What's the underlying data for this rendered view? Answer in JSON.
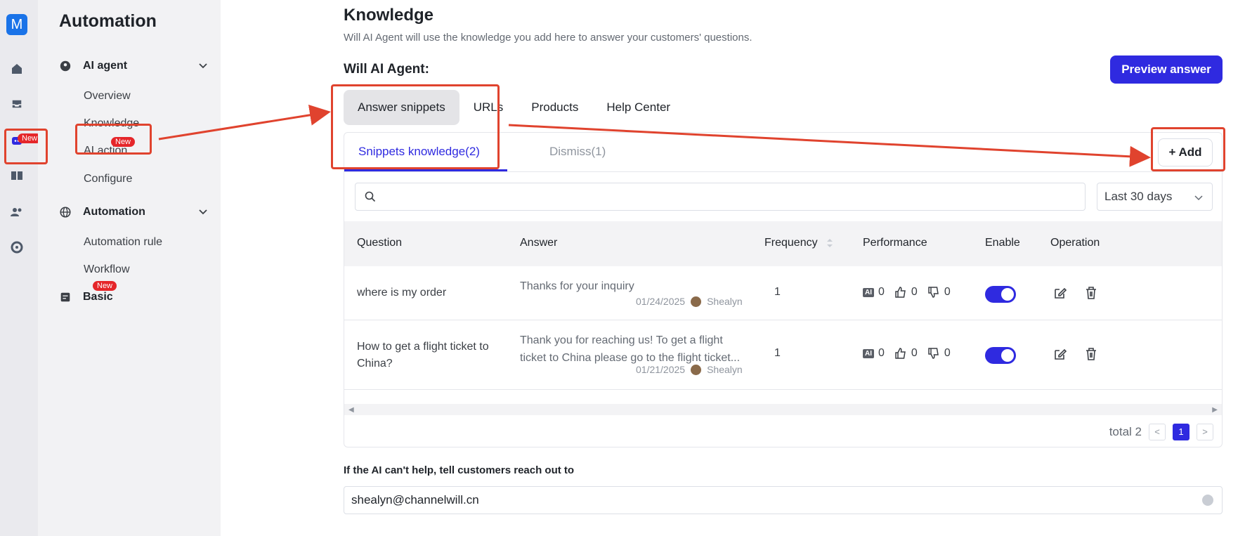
{
  "rail": {
    "logo": "M",
    "new_badge": "New"
  },
  "sidebar": {
    "title": "Automation",
    "groups": [
      {
        "label": "AI agent",
        "items": [
          "Overview",
          "Knowledge",
          "AI action",
          "Configure"
        ],
        "item_badges": {
          "AI action": "New"
        }
      },
      {
        "label": "Automation",
        "items": [
          "Automation rule",
          "Workflow"
        ]
      },
      {
        "label": "Basic",
        "badge": "New"
      }
    ]
  },
  "main": {
    "title": "Knowledge",
    "description": "Will AI Agent will use the knowledge you add here to answer your customers' questions.",
    "subtitle": "Will AI Agent:",
    "preview_button": "Preview answer",
    "tabs": [
      "Answer snippets",
      "URLs",
      "Products",
      "Help Center"
    ],
    "subtabs": [
      "Snippets knowledge(2)",
      "Dismiss(1)"
    ],
    "add_button": "+ Add",
    "search": {
      "placeholder": ""
    },
    "date_range": "Last 30 days",
    "columns": [
      "Question",
      "Answer",
      "Frequency",
      "Performance",
      "Enable",
      "Operation"
    ],
    "rows": [
      {
        "question": "where is my order",
        "answer": "Thanks for your inquiry",
        "date": "01/24/2025",
        "author": "Shealyn",
        "frequency": "1",
        "ai": "0",
        "up": "0",
        "down": "0",
        "enabled": true
      },
      {
        "question": "How to get a flight ticket to China?",
        "answer": "Thank you for reaching us! To get a flight ticket to China please go to the flight ticket...",
        "date": "01/21/2025",
        "author": "Shealyn",
        "frequency": "1",
        "ai": "0",
        "up": "0",
        "down": "0",
        "enabled": true
      }
    ],
    "pager": {
      "total": "total 2",
      "current": "1"
    },
    "ai_label": "AI",
    "help_label": "If the AI can't help, tell customers reach out to",
    "help_value": "shealyn@channelwill.cn"
  }
}
